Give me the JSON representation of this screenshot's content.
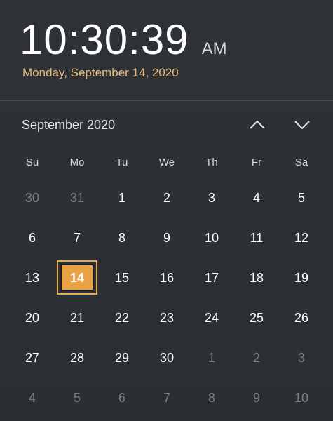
{
  "clock": {
    "time": "10:30:39",
    "ampm": "AM",
    "date_long": "Monday, September 14, 2020"
  },
  "calendar": {
    "month_label": "September 2020",
    "nav": {
      "prev_icon": "chevron-up-icon",
      "next_icon": "chevron-down-icon"
    },
    "weekdays": [
      "Su",
      "Mo",
      "Tu",
      "We",
      "Th",
      "Fr",
      "Sa"
    ],
    "weeks": [
      [
        {
          "d": "30",
          "other": true
        },
        {
          "d": "31",
          "other": true
        },
        {
          "d": "1"
        },
        {
          "d": "2"
        },
        {
          "d": "3"
        },
        {
          "d": "4"
        },
        {
          "d": "5"
        }
      ],
      [
        {
          "d": "6"
        },
        {
          "d": "7"
        },
        {
          "d": "8"
        },
        {
          "d": "9"
        },
        {
          "d": "10"
        },
        {
          "d": "11"
        },
        {
          "d": "12"
        }
      ],
      [
        {
          "d": "13"
        },
        {
          "d": "14",
          "today": true
        },
        {
          "d": "15"
        },
        {
          "d": "16"
        },
        {
          "d": "17"
        },
        {
          "d": "18"
        },
        {
          "d": "19"
        }
      ],
      [
        {
          "d": "20"
        },
        {
          "d": "21"
        },
        {
          "d": "22"
        },
        {
          "d": "23"
        },
        {
          "d": "24"
        },
        {
          "d": "25"
        },
        {
          "d": "26"
        }
      ],
      [
        {
          "d": "27"
        },
        {
          "d": "28"
        },
        {
          "d": "29"
        },
        {
          "d": "30"
        },
        {
          "d": "1",
          "other": true
        },
        {
          "d": "2",
          "other": true
        },
        {
          "d": "3",
          "other": true
        }
      ],
      [
        {
          "d": "4",
          "other": true
        },
        {
          "d": "5",
          "other": true
        },
        {
          "d": "6",
          "other": true
        },
        {
          "d": "7",
          "other": true
        },
        {
          "d": "8",
          "other": true
        },
        {
          "d": "9",
          "other": true
        },
        {
          "d": "10",
          "other": true
        }
      ]
    ]
  },
  "colors": {
    "background": "#2f3338",
    "accent": "#e8a243",
    "date_link": "#e7b97a",
    "muted_day": "#7a7f86"
  }
}
